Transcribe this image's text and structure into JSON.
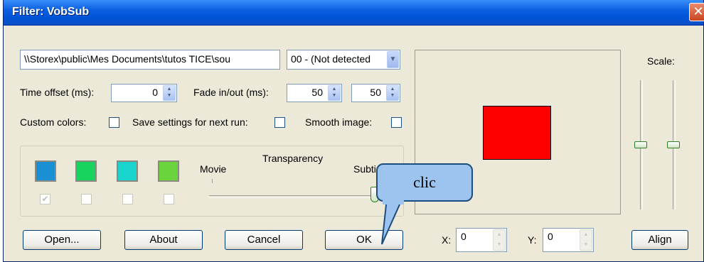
{
  "window": {
    "title": "Filter: VobSub",
    "close_symbol": "✕"
  },
  "file_path": "\\\\Storex\\public\\Mes Documents\\tutos TICE\\sou",
  "stream_select": {
    "selected": "00 - (Not detected"
  },
  "time_offset": {
    "label": "Time offset (ms):",
    "value": "0"
  },
  "fade": {
    "label": "Fade in/out (ms):",
    "in_value": "50",
    "out_value": "50"
  },
  "options": {
    "custom_colors_label": "Custom colors:",
    "save_settings_label": "Save settings for next run:",
    "smooth_image_label": "Smooth image:",
    "custom_colors_checked": false,
    "save_settings_checked": false,
    "smooth_image_checked": false
  },
  "colors": {
    "swatches": [
      "#1a8fd4",
      "#18d45e",
      "#19d4cc",
      "#6ad43c"
    ],
    "swatch_checks": [
      true,
      false,
      false,
      false
    ]
  },
  "transparency": {
    "title": "Transparency",
    "left_label": "Movie",
    "right_label": "Subti",
    "level": 1.0
  },
  "preview": {
    "subtitle_color": "#ff0000"
  },
  "scale": {
    "label": "Scale:",
    "x_level": 0.5,
    "y_level": 0.5
  },
  "position": {
    "x_label": "X:",
    "x_value": "0",
    "y_label": "Y:",
    "y_value": "0"
  },
  "buttons": {
    "open": "Open...",
    "about": "About",
    "cancel": "Cancel",
    "ok": "OK",
    "align": "Align"
  },
  "annotation": {
    "text": "clic"
  },
  "icons": {
    "close": "close-icon",
    "dropdown": "chevron-down-icon",
    "spin": "spin-arrows-icon"
  }
}
